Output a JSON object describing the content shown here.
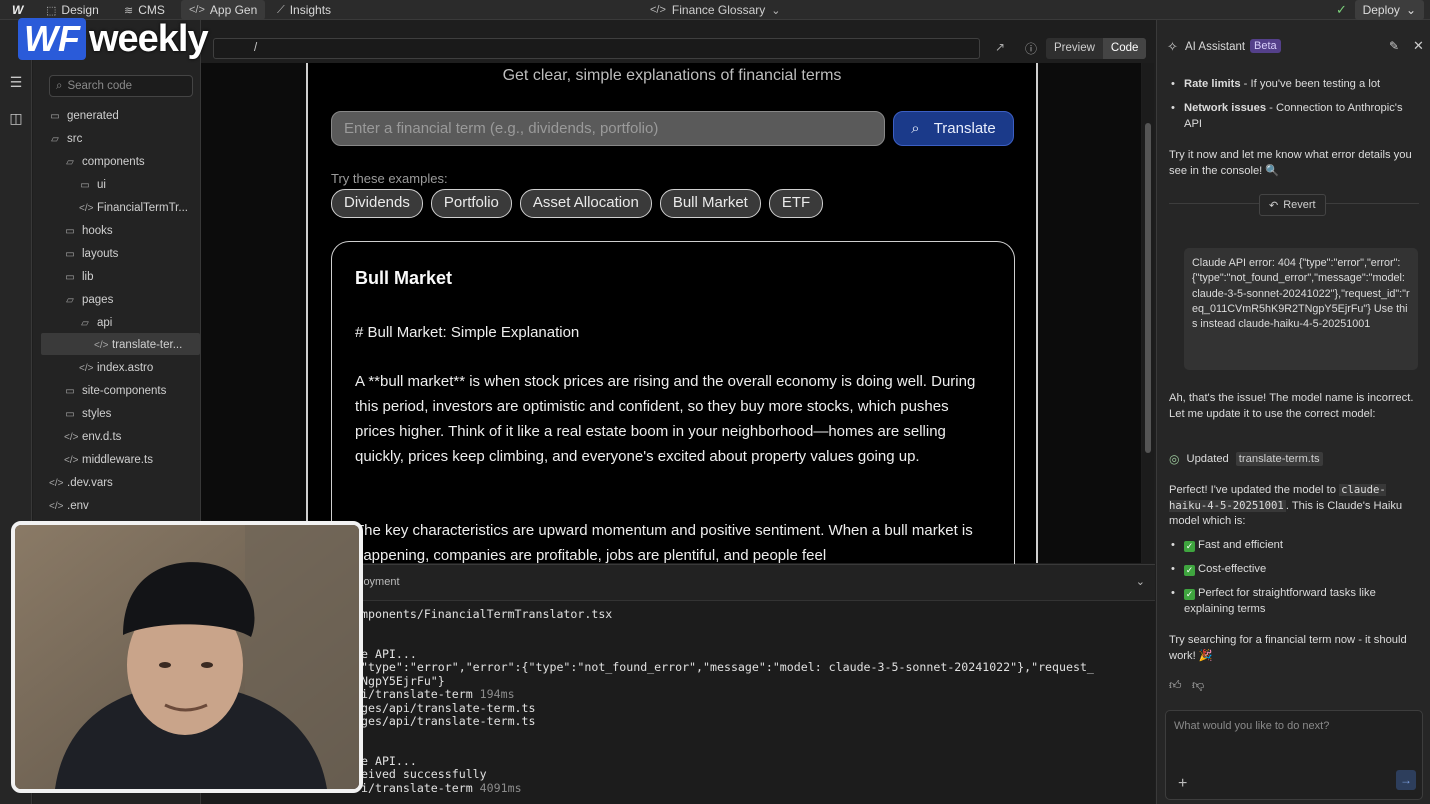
{
  "topbar": {
    "design": "Design",
    "cms": "CMS",
    "app_gen": "App Gen",
    "insights": "Insights",
    "site_title": "Finance Glossary",
    "deploy": "Deploy"
  },
  "overlay": {
    "logo_wf": "WF",
    "logo_weekly": "weekly"
  },
  "filetree": {
    "search_placeholder": "Search code",
    "items": [
      {
        "label": "generated"
      },
      {
        "label": "src"
      },
      {
        "label": "components"
      },
      {
        "label": "ui"
      },
      {
        "label": "FinancialTermTr..."
      },
      {
        "label": "hooks"
      },
      {
        "label": "layouts"
      },
      {
        "label": "lib"
      },
      {
        "label": "pages"
      },
      {
        "label": "api"
      },
      {
        "label": "translate-ter..."
      },
      {
        "label": "index.astro"
      },
      {
        "label": "site-components"
      },
      {
        "label": "styles"
      },
      {
        "label": "env.d.ts"
      },
      {
        "label": "middleware.ts"
      },
      {
        "label": ".dev.vars"
      },
      {
        "label": ".env"
      }
    ]
  },
  "urlbar": {
    "path": "/",
    "preview": "Preview",
    "code": "Code"
  },
  "preview": {
    "subtitle": "Get clear, simple explanations of financial terms",
    "input_placeholder": "Enter a financial term (e.g., dividends, portfolio)",
    "translate": "Translate",
    "try_label": "Try these examples:",
    "examples": [
      "Dividends",
      "Portfolio",
      "Asset Allocation",
      "Bull Market",
      "ETF"
    ],
    "result_title": "Bull Market",
    "result_heading": "# Bull Market: Simple Explanation",
    "result_p1": "A **bull market** is when stock prices are rising and the overall economy is doing well. During this period, investors are optimistic and confident, so they buy more stocks, which pushes prices higher. Think of it like a real estate boom in your neighborhood—homes are selling quickly, prices keep climbing, and everyone's excited about property values going up.",
    "result_p2": "The key characteristics are upward momentum and positive sentiment. When a bull market is happening, companies are profitable, jobs are plentiful, and people feel"
  },
  "console": {
    "tab": "loyment",
    "lines": [
      {
        "text": "mponents/FinancialTermTranslator.tsx",
        "dim": ""
      },
      {
        "text": "",
        "dim": ""
      },
      {
        "text": "e API...",
        "dim": ""
      },
      {
        "text": "\"type\":\"error\",\"error\":{\"type\":\"not_found_error\",\"message\":\"model: claude-3-5-sonnet-20241022\"},\"request_",
        "dim": ""
      },
      {
        "text": "NgpY5EjrFu\"}",
        "dim": ""
      },
      {
        "text": "i/translate-term ",
        "dim": "194ms"
      },
      {
        "text": "ges/api/translate-term.ts",
        "dim": ""
      },
      {
        "text": "ges/api/translate-term.ts",
        "dim": ""
      },
      {
        "text": "",
        "dim": ""
      },
      {
        "text": "e API...",
        "dim": ""
      },
      {
        "text": "eived successfully",
        "dim": ""
      },
      {
        "text": "i/translate-term ",
        "dim": "4091ms"
      }
    ]
  },
  "ai": {
    "title": "AI Assistant",
    "beta": "Beta",
    "b1_bold": "Rate limits",
    "b1_text": " - If you've been testing a lot",
    "b2_bold": "Network issues",
    "b2_text": " - Connection to Anthropic's API",
    "try_now": "Try it now and let me know what error details you see in the console! 🔍",
    "revert": "Revert",
    "user_msg": "Claude API error: 404 {\"type\":\"error\",\"error\":{\"type\":\"not_found_error\",\"message\":\"model: claude-3-5-sonnet-20241022\"},\"request_id\":\"req_011CVmR5hK9R2TNgpY5EjrFu\"} Use this instead claude-haiku-4-5-20251001",
    "issue": "Ah, that's the issue! The model name is incorrect. Let me update it to use the correct model:",
    "updated": "Updated",
    "updated_file": "translate-term.ts",
    "perfect_1": "Perfect! I've updated the model to ",
    "perfect_code": "claude-haiku-4-5-20251001",
    "perfect_2": ". This is Claude's Haiku model which is:",
    "li1": "Fast and efficient",
    "li2": "Cost-effective",
    "li3": "Perfect for straightforward tasks like explaining terms",
    "try_search": "Try searching for a financial term now - it should work! 🎉",
    "input_placeholder": "What would you like to do next?"
  }
}
